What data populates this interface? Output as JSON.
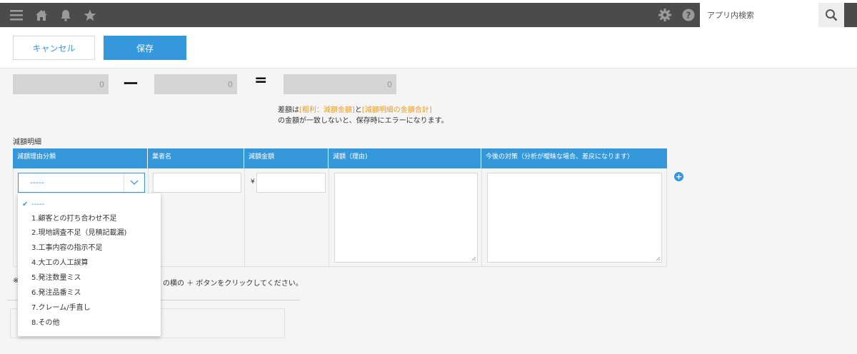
{
  "header": {
    "search_placeholder": "アプリ内検索"
  },
  "toolbar": {
    "cancel_label": "キャンセル",
    "save_label": "保存"
  },
  "calc": {
    "value1": "0",
    "value2": "0",
    "result": "0",
    "minus": "ー",
    "equals": "="
  },
  "warning": {
    "line1_prefix": "差額は",
    "field1": "[粗利：減額金額]",
    "and": "と",
    "field2": "[減額明細の金額合計]",
    "line2": "の金額が一致しないと、保存時にエラーになります。"
  },
  "table": {
    "section_label": "減額明細",
    "columns": [
      "減額理由分類",
      "業者名",
      "減額金額",
      "減額（理由)",
      "今後の対策（分析が曖昧な場合、差戻になります）"
    ],
    "yen": "¥",
    "select_value": "-----"
  },
  "dropdown": {
    "options": [
      "-----",
      "1.顧客との打ち合わせ不足",
      "2.現地調査不足（見積記載漏)",
      "3.工事内容の指示不足",
      "4.大工の人工誤算",
      "5.発注数量ミス",
      "6.発注品番ミス",
      "7.クレーム/手直し",
      "8.その他"
    ],
    "selected_index": 0
  },
  "notes": {
    "prefix": "※",
    "text": "の横の ＋ ボタンをクリックしてください。"
  },
  "icons": [
    "menu-icon",
    "home-icon",
    "bell-icon",
    "star-icon",
    "gear-icon",
    "help-icon",
    "search-icon",
    "chevron-down-icon",
    "add-row-icon",
    "check-icon",
    "resize-grip-icon"
  ],
  "colors": {
    "accent": "#3498db",
    "header_bg": "#4b4b4b",
    "highlight": "#f39c12"
  }
}
